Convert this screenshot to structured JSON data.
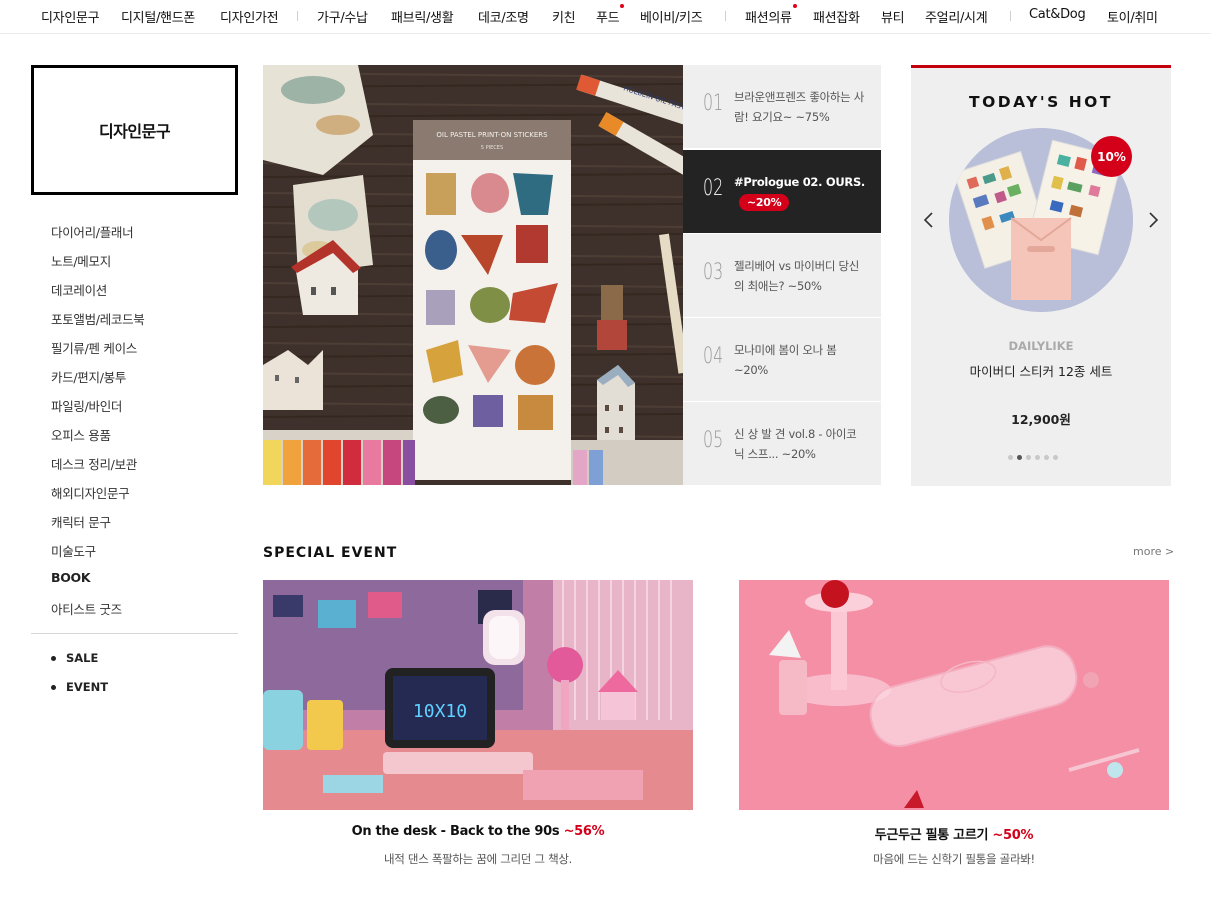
{
  "nav": {
    "items": [
      {
        "label": "디자인문구",
        "dot": false
      },
      {
        "label": "디지털/핸드폰",
        "dot": false
      },
      {
        "label": "디자인가전",
        "dot": false
      },
      {
        "label": "가구/수납",
        "dot": false
      },
      {
        "label": "패브릭/생활",
        "dot": false
      },
      {
        "label": "데코/조명",
        "dot": false
      },
      {
        "label": "키친",
        "dot": false
      },
      {
        "label": "푸드",
        "dot": true
      },
      {
        "label": "베이비/키즈",
        "dot": false
      },
      {
        "label": "패션의류",
        "dot": true
      },
      {
        "label": "패션잡화",
        "dot": false
      },
      {
        "label": "뷰티",
        "dot": false
      },
      {
        "label": "주얼리/시계",
        "dot": false
      },
      {
        "label": "Cat&Dog",
        "dot": false
      },
      {
        "label": "토이/취미",
        "dot": false
      }
    ],
    "accent_color": "#e0001b"
  },
  "sidebar": {
    "category_title": "디자인문구",
    "items": [
      {
        "label": "다이어리/플래너"
      },
      {
        "label": "노트/메모지"
      },
      {
        "label": "데코레이션"
      },
      {
        "label": "포토앨범/레코드북"
      },
      {
        "label": "필기류/펜 케이스"
      },
      {
        "label": "카드/편지/봉투"
      },
      {
        "label": "파일링/바인더"
      },
      {
        "label": "오피스 용품"
      },
      {
        "label": "데스크 정리/보관"
      },
      {
        "label": "해외디자인문구"
      },
      {
        "label": "캐릭터 문구"
      },
      {
        "label": "미술도구"
      },
      {
        "label": "BOOK"
      },
      {
        "label": "아티스트 굿즈"
      }
    ],
    "extra": [
      {
        "label": "SALE"
      },
      {
        "label": "EVENT"
      }
    ]
  },
  "hero": {
    "sticker_sheet_title": "OIL PASTEL PRINT-ON STICKERS",
    "sticker_sheet_sub": "5 PIECES",
    "crayon_label": "HOLBEIN OIL PASTEL",
    "list": [
      {
        "num": "01",
        "text": "브라운앤프렌즈 좋아하는 사람! 요기요~ ~75%",
        "badge": ""
      },
      {
        "num": "02",
        "text": "#Prologue 02. OURS.",
        "badge": "~20%"
      },
      {
        "num": "03",
        "text": "젤리베어 vs 마이버디 당신의 최애는? ~50%",
        "badge": ""
      },
      {
        "num": "04",
        "text": "모나미에 봄이 오나 봄 ~20%",
        "badge": ""
      },
      {
        "num": "05",
        "text": "신 상 발 견 vol.8 - 아이코닉 스프... ~20%",
        "badge": ""
      }
    ],
    "active_index": 1
  },
  "todays_hot": {
    "title": "TODAY'S HOT",
    "discount_badge": "10%",
    "brand": "DAILYLIKE",
    "product_name": "마이버디 스티커 12종 세트",
    "price": "12,900원",
    "slide_count": 6,
    "active_slide": 1,
    "prev_icon": "chevron-left-icon",
    "next_icon": "chevron-right-icon",
    "accent_color": "#c4000e"
  },
  "special_event": {
    "title": "SPECIAL EVENT",
    "more_label": "more >",
    "events": [
      {
        "title": "On the desk - Back to the 90s",
        "discount": "~56%",
        "subtitle": "내적 댄스 폭팔하는 꿈에 그리던 그 책상.",
        "image_text": "10X10"
      },
      {
        "title": "두근두근 필통 고르기",
        "discount": "~50%",
        "subtitle": "마음에 드는 신학기 필통을 골라봐!",
        "image_text": ""
      }
    ]
  }
}
